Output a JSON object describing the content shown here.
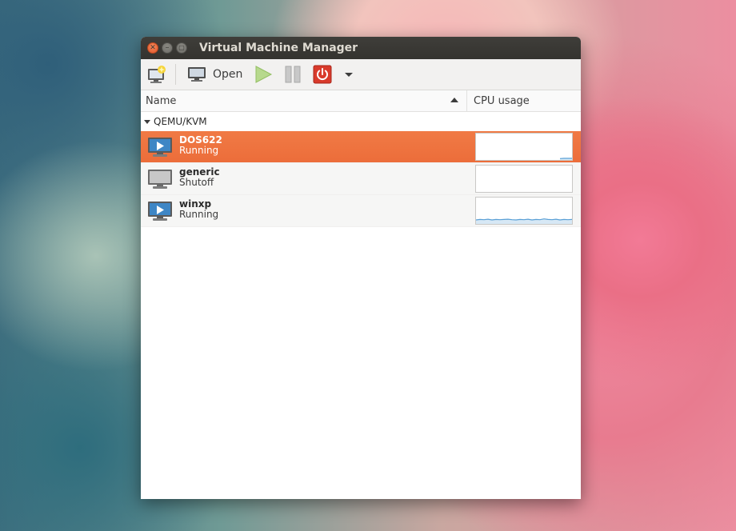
{
  "window": {
    "title": "Virtual Machine Manager"
  },
  "toolbar": {
    "open_label": "Open",
    "icons": [
      "new-vm-icon",
      "monitor-icon",
      "play-icon",
      "pause-icon",
      "power-icon",
      "dropdown-icon"
    ]
  },
  "columns": {
    "name": "Name",
    "cpu": "CPU usage"
  },
  "group": {
    "label": "QEMU/KVM"
  },
  "vms": [
    {
      "name": "DOS622",
      "status": "Running",
      "selected": true,
      "cpu": [
        0,
        0,
        0,
        0,
        0,
        0,
        0,
        0,
        0,
        0,
        0,
        0,
        0,
        0,
        0,
        0,
        0,
        0,
        0,
        0,
        0,
        2,
        3,
        3,
        3
      ]
    },
    {
      "name": "generic",
      "status": "Shutoff",
      "selected": false,
      "cpu": []
    },
    {
      "name": "winxp",
      "status": "Running",
      "selected": false,
      "cpu": [
        12,
        14,
        13,
        15,
        12,
        14,
        13,
        14,
        15,
        13,
        12,
        14,
        13,
        15,
        12,
        14,
        13,
        16,
        14,
        13,
        15,
        12,
        14,
        13,
        14
      ]
    }
  ],
  "colors": {
    "accent": "#ec6d3a",
    "graph_line": "#5aa0d6",
    "graph_fill": "#bcd9ee"
  }
}
